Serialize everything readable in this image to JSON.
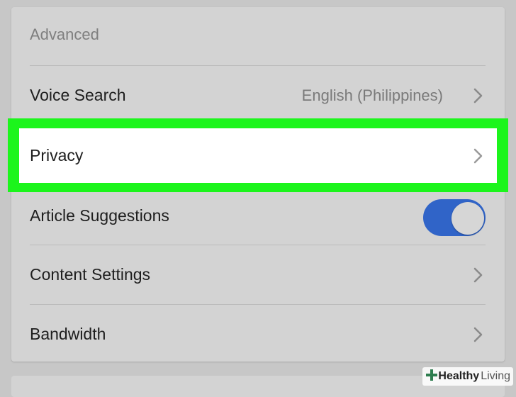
{
  "section": {
    "title": "Advanced"
  },
  "rows": {
    "voice_search": {
      "label": "Voice Search",
      "value": "English (Philippines)"
    },
    "privacy": {
      "label": "Privacy"
    },
    "article_suggestions": {
      "label": "Article Suggestions",
      "toggle_on": true
    },
    "content_settings": {
      "label": "Content Settings"
    },
    "bandwidth": {
      "label": "Bandwidth"
    }
  },
  "icons": {
    "chevron": "chevron-right-icon",
    "logo": "plus-logo-icon"
  },
  "colors": {
    "highlight": "#1cf51c",
    "toggle_accent": "#3064c8"
  },
  "watermark": {
    "bold": "Healthy",
    "regular": "Living"
  }
}
